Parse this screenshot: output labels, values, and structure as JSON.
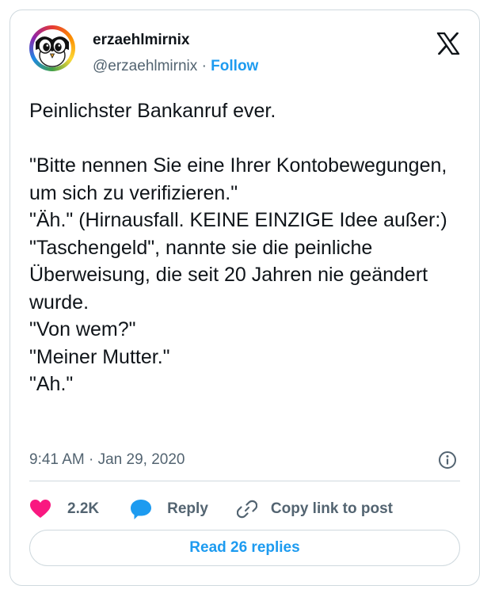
{
  "author": {
    "display_name": "erzaehlmirnix",
    "handle": "@erzaehlmirnix",
    "separator": "·",
    "follow_label": "Follow",
    "avatar_icon": "owl-face-icon"
  },
  "platform_icon": "x-logo-icon",
  "tweet": {
    "text": "Peinlichster Bankanruf ever.\n\n\"Bitte nennen Sie eine Ihrer Kontobewegungen, um sich zu verifizieren.\"\n\"Äh.\" (Hirnausfall. KEINE EINZIGE Idee außer:) \"Taschengeld\", nannte sie die peinliche Überweisung, die seit 20 Jahren nie geändert wurde.\n\"Von wem?\"\n\"Meiner Mutter.\"\n\"Ah.\"",
    "timestamp": "9:41 AM · Jan 29, 2020"
  },
  "actions": {
    "like_count": "2.2K",
    "reply_label": "Reply",
    "copy_link_label": "Copy link to post"
  },
  "read_replies_label": "Read 26 replies",
  "colors": {
    "accent": "#1d9bf0",
    "like": "#f91880",
    "text": "#0f1419",
    "muted": "#536471",
    "border": "#cfd9de"
  }
}
